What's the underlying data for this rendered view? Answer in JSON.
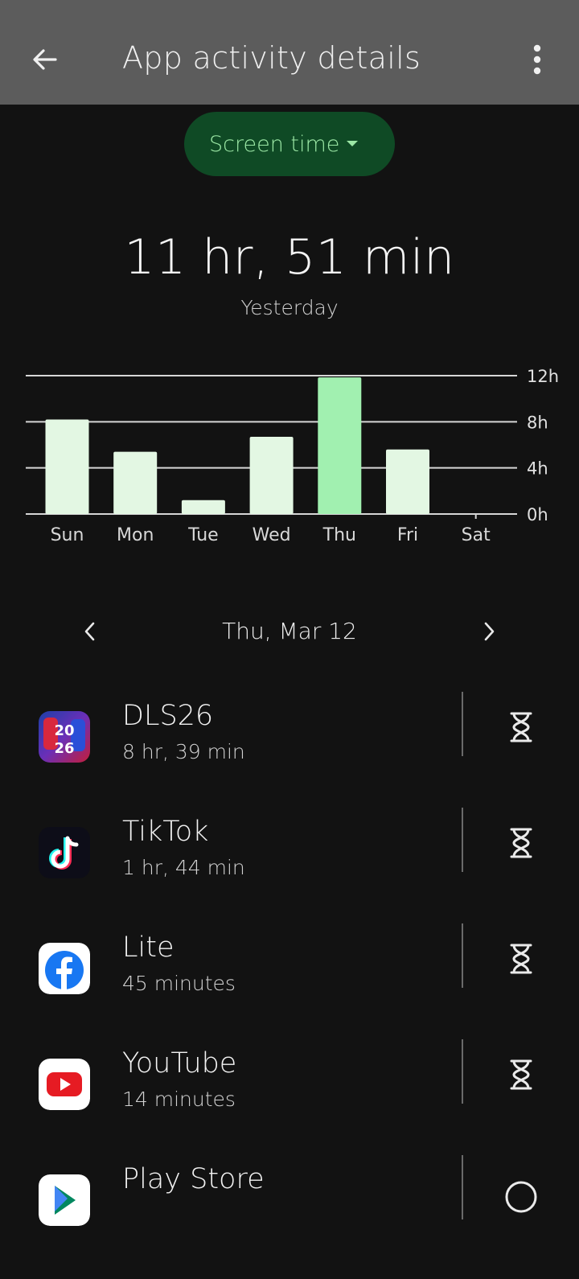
{
  "header": {
    "title": "App activity details",
    "back_icon": "arrow-left-icon",
    "menu_icon": "more-vert-icon"
  },
  "metric_selector": {
    "label": "Screen time",
    "icon": "caret-down-icon"
  },
  "summary": {
    "total": "11 hr, 51 min",
    "period": "Yesterday"
  },
  "chart_data": {
    "type": "bar",
    "categories": [
      "Sun",
      "Mon",
      "Tue",
      "Wed",
      "Thu",
      "Fri",
      "Sat"
    ],
    "values": [
      8.2,
      5.4,
      1.2,
      6.7,
      11.85,
      5.6,
      0
    ],
    "highlight_index": 4,
    "ylim": [
      0,
      12
    ],
    "yticks": [
      "0h",
      "4h",
      "8h",
      "12h"
    ],
    "ytick_values": [
      0,
      4,
      8,
      12
    ],
    "colors": {
      "bar": "#e3f7e3",
      "highlight": "#a1f0b0",
      "grid": "#d6d6d6"
    },
    "grid": true
  },
  "day_nav": {
    "date": "Thu, Mar 12",
    "prev_icon": "chevron-left-icon",
    "next_icon": "chevron-right-icon"
  },
  "apps": [
    {
      "name": "DLS26",
      "time": "8 hr, 39 min",
      "icon": "dls26-app-icon"
    },
    {
      "name": "TikTok",
      "time": "1 hr, 44 min",
      "icon": "tiktok-app-icon"
    },
    {
      "name": "Lite",
      "time": "45 minutes",
      "icon": "facebook-lite-app-icon"
    },
    {
      "name": "YouTube",
      "time": "14 minutes",
      "icon": "youtube-app-icon"
    },
    {
      "name": "Play Store",
      "time": "",
      "icon": "play-store-app-icon"
    }
  ],
  "timer_icon": "hourglass-icon"
}
